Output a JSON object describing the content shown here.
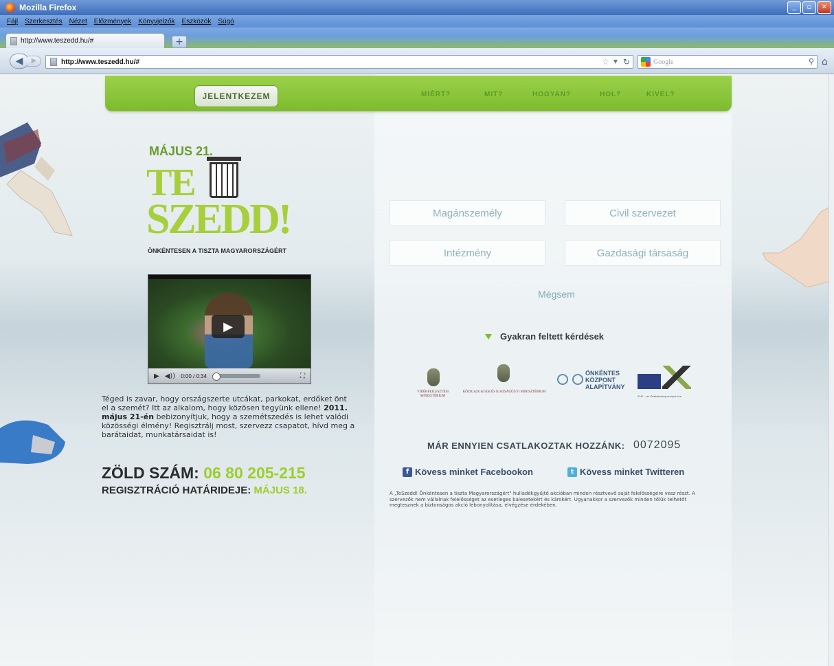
{
  "browser": {
    "title": "Mozilla Firefox",
    "menu": [
      "Fájl",
      "Szerkesztés",
      "Nézet",
      "Előzmények",
      "Könyvjelzők",
      "Eszközök",
      "Súgó"
    ],
    "tab_title": "http://www.teszedd.hu/#",
    "url": "http://www.teszedd.hu/#",
    "search_placeholder": "Google"
  },
  "nav": {
    "signup": "JELENTKEZEM",
    "links": [
      "MIÉRT?",
      "MIT?",
      "HOGYAN?",
      "HOL?",
      "KIVEL?"
    ]
  },
  "logo": {
    "top": "MÁJUS 21.",
    "te": "TE",
    "szedd": "SZEDD!",
    "subtitle": "ÖNKÉNTESEN A TISZTA MAGYARORSZÁGÉRT"
  },
  "video": {
    "time": "0:00 / 0:34"
  },
  "intro": {
    "part1": "Téged is zavar, hogy országszerte utcákat, parkokat, erdőket önt el a szemét? Itt az alkalom, hogy közösen tegyünk ellene! ",
    "bold": "2011. május 21-én",
    "part2": " bebizonyítjuk, hogy a szemétszedés is lehet valódi közösségi élmény! Regisztrálj most, szervezz csapatot, hívd meg a barátaidat, munkatársaidat is!"
  },
  "green_number": {
    "label": "ZÖLD SZÁM: ",
    "number": "06 80 205-215"
  },
  "deadline": {
    "label": "REGISZTRÁCIÓ HATÁRIDEJE: ",
    "date": "MÁJUS 18."
  },
  "choices": {
    "private": "Magánszemély",
    "civil": "Civil szervezet",
    "institution": "Intézmény",
    "company": "Gazdasági társaság",
    "cancel": "Mégsem"
  },
  "faq": "Gyakran feltett kérdések",
  "sponsors": {
    "ministry1": "VIDÉKFEJLESZTÉSI MINISZTÉRIUM",
    "ministry2": "KÖZIGAZGATÁSI ÉS IGAZSÁGÜGYI MINISZTÉRIUM",
    "okt": [
      "ÖNKÉNTES",
      "KÖZPONT",
      "ALAPÍTVÁNY"
    ],
    "eu": "2011 – az Önkéntesség európai éve"
  },
  "joined": {
    "label": "MÁR ENNYIEN CSATLAKOZTAK HOZZÁNK:",
    "count": "0072095"
  },
  "social": {
    "facebook": "Kövess minket Facebookon",
    "twitter": "Kövess minket Twitteren"
  },
  "disclaimer": "A „TeSzedd! Önkéntesen a tiszta Magyarországért\" hulladékgyűjtő akcióban minden résztvevő saját felelősségére vesz részt. A szervezők nem vállalnak felelősséget az esetleges balesetekért és károkért. Ugyanakkor a szervezők minden tőlük telhetőt megtesznek a biztonságos akció lebonyolítása, elvégzése érdekében."
}
